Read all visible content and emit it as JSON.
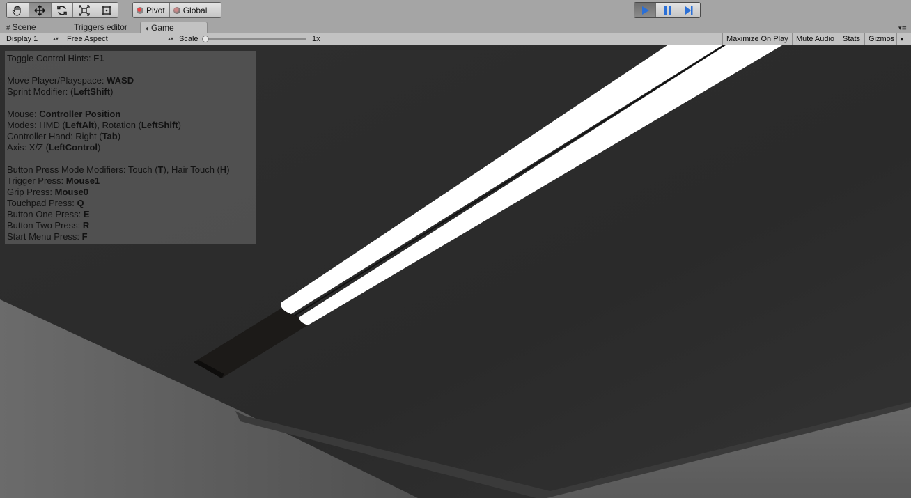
{
  "toolbar": {
    "tools": [
      {
        "name": "hand-tool",
        "icon": "hand-icon",
        "active": false
      },
      {
        "name": "move-tool",
        "icon": "move-arrows-icon",
        "active": true
      },
      {
        "name": "rotate-tool",
        "icon": "rotate-icon",
        "active": false
      },
      {
        "name": "scale-tool",
        "icon": "scale-icon",
        "active": false
      },
      {
        "name": "rect-tool",
        "icon": "rect-transform-icon",
        "active": false
      }
    ],
    "pivot_label": "Pivot",
    "global_label": "Global",
    "playback": {
      "play_icon": "play-icon",
      "pause_icon": "pause-icon",
      "step_icon": "step-icon",
      "playing": true,
      "accent": "#2a6fd6"
    }
  },
  "tabs": {
    "scene": "Scene",
    "triggers": "Triggers editor",
    "game": "Game",
    "active": "Game"
  },
  "gamebar": {
    "display": "Display 1",
    "aspect": "Free Aspect",
    "scale_label": "Scale",
    "scale_value": "1x",
    "maximize": "Maximize On Play",
    "mute": "Mute Audio",
    "stats": "Stats",
    "gizmos": "Gizmos"
  },
  "hints": {
    "toggle_label": "Toggle Control Hints: ",
    "toggle_key": "F1",
    "move_label": "Move Player/Playspace: ",
    "move_key": "WASD",
    "sprint_label": "Sprint Modifier: (",
    "sprint_key": "LeftShift",
    "sprint_end": ")",
    "mouse_label": "Mouse: ",
    "mouse_key": "Controller Position",
    "modes_label": "Modes: HMD (",
    "modes_key1": "LeftAlt",
    "modes_mid": "), Rotation (",
    "modes_key2": "LeftShift",
    "modes_end": ")",
    "hand_label": "Controller Hand: Right (",
    "hand_key": "Tab",
    "hand_end": ")",
    "axis_label": "Axis: X/Z (",
    "axis_key": "LeftControl",
    "axis_end": ")",
    "bpm_label": "Button Press Mode Modifiers: Touch (",
    "bpm_key1": "T",
    "bpm_mid": "), Hair Touch (",
    "bpm_key2": "H",
    "bpm_end": ")",
    "trigger_label": "Trigger Press: ",
    "trigger_key": "Mouse1",
    "grip_label": "Grip Press: ",
    "grip_key": "Mouse0",
    "touchpad_label": "Touchpad Press: ",
    "touchpad_key": "Q",
    "b1_label": "Button One Press: ",
    "b1_key": "E",
    "b2_label": "Button Two Press: ",
    "b2_key": "R",
    "start_label": "Start Menu Press: ",
    "start_key": "F"
  }
}
